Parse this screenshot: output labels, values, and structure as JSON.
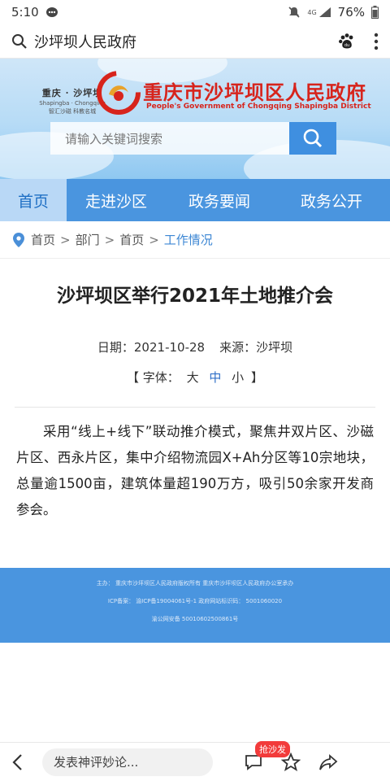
{
  "status_bar": {
    "time": "5:10",
    "network": "4G",
    "battery": "76%"
  },
  "address_bar": {
    "title": "沙坪坝人民政府"
  },
  "banner": {
    "logo_line1": "重庆 · 沙坪坝",
    "logo_line2": "Shapingba · Chongqing",
    "logo_line3": "智汇沙磁  科教名城",
    "gov_title": "重庆市沙坪坝区人民政府",
    "gov_subtitle": "People's Government of Chongqing Shapingba District",
    "search_placeholder": "请输入关键词搜索"
  },
  "nav": {
    "items": [
      {
        "label": "首页"
      },
      {
        "label": "走进沙区"
      },
      {
        "label": "政务要闻"
      },
      {
        "label": "政务公开"
      }
    ]
  },
  "breadcrumb": {
    "items": [
      "首页",
      "部门",
      "首页",
      "工作情况"
    ],
    "separator": ">"
  },
  "article": {
    "title": "沙坪坝区举行2021年土地推介会",
    "date_label": "日期：2021-10-28",
    "source_label": "来源：沙坪坝",
    "font_label_open": "【 字体：",
    "font_large": "大",
    "font_medium": "中",
    "font_small": "小",
    "font_label_close": "】",
    "body": "采用“线上+线下”联动推介模式，聚焦井双片区、沙磁片区、西永片区，集中介绍物流园X+Ah分区等10宗地块，总量逾1500亩，建筑体量超190万方，吸引50余家开发商参会。"
  },
  "footer": {
    "line1": "主办：   重庆市沙坪坝区人民政府版权所有     重庆市沙坪坝区人民政府办公室承办",
    "line2": "ICP备案：  渝ICP备19004061号-1      政府网站标识码：  5001060020",
    "line3": "渝公网安备   50010602500861号"
  },
  "bottom_bar": {
    "comment_placeholder": "发表神评妙论...",
    "badge": "抢沙发"
  },
  "colors": {
    "nav_blue": "#4a95df",
    "gov_red": "#d7241c",
    "breadcrumb_active": "#3d87d4"
  }
}
